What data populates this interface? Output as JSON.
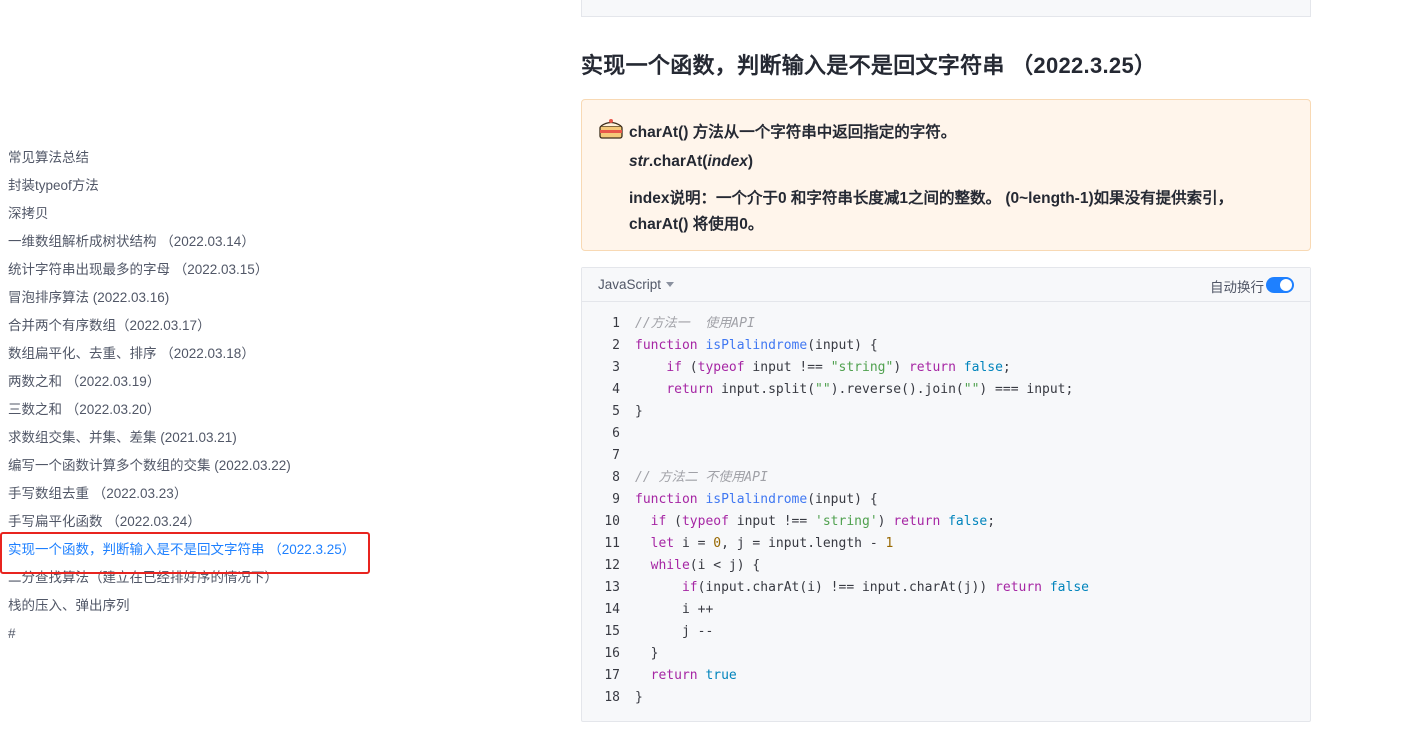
{
  "toc": {
    "items": [
      {
        "label": "常见算法总结"
      },
      {
        "label": "封装typeof方法"
      },
      {
        "label": "深拷贝"
      },
      {
        "label": "一维数组解析成树状结构 （2022.03.14）"
      },
      {
        "label": "统计字符串出现最多的字母 （2022.03.15）"
      },
      {
        "label": "冒泡排序算法 (2022.03.16)"
      },
      {
        "label": "合并两个有序数组（2022.03.17）"
      },
      {
        "label": "数组扁平化、去重、排序 （2022.03.18）"
      },
      {
        "label": "两数之和 （2022.03.19）"
      },
      {
        "label": "三数之和 （2022.03.20）"
      },
      {
        "label": "求数组交集、并集、差集 (2021.03.21)"
      },
      {
        "label": "编写一个函数计算多个数组的交集 (2022.03.22)"
      },
      {
        "label": "手写数组去重 （2022.03.23）"
      },
      {
        "label": "手写扁平化函数 （2022.03.24）"
      },
      {
        "label": "实现一个函数，判断输入是不是回文字符串 （2022.3.25）",
        "active": true
      },
      {
        "label": "二分查找算法（建立在已经排好序的情况下）"
      },
      {
        "label": "栈的压入、弹出序列"
      },
      {
        "label": "#"
      }
    ]
  },
  "article": {
    "title": "实现一个函数，判断输入是不是回文字符串 （2022.3.25）",
    "tip": {
      "icon": "cake-icon",
      "line1": "charAt() 方法从一个字符串中返回指定的字符。",
      "line2_str": "str",
      "line2_method": ".charAt(",
      "line2_param": "index",
      "line2_close": ")",
      "line3": "index说明：一个介于0 和字符串长度减1之间的整数。 (0~length-1)如果没有提供索引，",
      "line4": "charAt() 将使用0。"
    },
    "code": {
      "language": "JavaScript",
      "wrap_label": "自动换行",
      "wrap_enabled": true,
      "lines": [
        [
          [
            "c",
            "//方法一  使用API"
          ]
        ],
        [
          [
            "k",
            "function "
          ],
          [
            "f",
            "isPlalindrome"
          ],
          [
            "p",
            "(input) {"
          ]
        ],
        [
          [
            "p",
            "    "
          ],
          [
            "k",
            "if"
          ],
          [
            "p",
            " ("
          ],
          [
            "k",
            "typeof"
          ],
          [
            "p",
            " input !== "
          ],
          [
            "s",
            "\"string\""
          ],
          [
            "p",
            ") "
          ],
          [
            "k",
            "return "
          ],
          [
            "b",
            "false"
          ],
          [
            "p",
            ";"
          ]
        ],
        [
          [
            "p",
            "    "
          ],
          [
            "k",
            "return"
          ],
          [
            "p",
            " input.split("
          ],
          [
            "s",
            "\"\""
          ],
          [
            "p",
            ").reverse().join("
          ],
          [
            "s",
            "\"\""
          ],
          [
            "p",
            ") === input;"
          ]
        ],
        [
          [
            "p",
            "}"
          ]
        ],
        [
          [
            "p",
            ""
          ]
        ],
        [
          [
            "p",
            ""
          ]
        ],
        [
          [
            "c",
            "// 方法二 不使用API"
          ]
        ],
        [
          [
            "k",
            "function "
          ],
          [
            "f",
            "isPlalindrome"
          ],
          [
            "p",
            "(input) {"
          ]
        ],
        [
          [
            "p",
            "  "
          ],
          [
            "k",
            "if"
          ],
          [
            "p",
            " ("
          ],
          [
            "k",
            "typeof"
          ],
          [
            "p",
            " input !== "
          ],
          [
            "s",
            "'string'"
          ],
          [
            "p",
            ") "
          ],
          [
            "k",
            "return "
          ],
          [
            "b",
            "false"
          ],
          [
            "p",
            ";"
          ]
        ],
        [
          [
            "p",
            "  "
          ],
          [
            "k",
            "let"
          ],
          [
            "p",
            " i = "
          ],
          [
            "n",
            "0"
          ],
          [
            "p",
            ", j = input.length - "
          ],
          [
            "n",
            "1"
          ]
        ],
        [
          [
            "p",
            "  "
          ],
          [
            "k",
            "while"
          ],
          [
            "p",
            "(i < j) {"
          ]
        ],
        [
          [
            "p",
            "      "
          ],
          [
            "k",
            "if"
          ],
          [
            "p",
            "(input.charAt(i) !== input.charAt(j)) "
          ],
          [
            "k",
            "return "
          ],
          [
            "b",
            "false"
          ]
        ],
        [
          [
            "p",
            "      i ++"
          ]
        ],
        [
          [
            "p",
            "      j --"
          ]
        ],
        [
          [
            "p",
            "  }"
          ]
        ],
        [
          [
            "p",
            "  "
          ],
          [
            "k",
            "return "
          ],
          [
            "b",
            "true"
          ]
        ],
        [
          [
            "p",
            "}"
          ]
        ]
      ]
    }
  }
}
